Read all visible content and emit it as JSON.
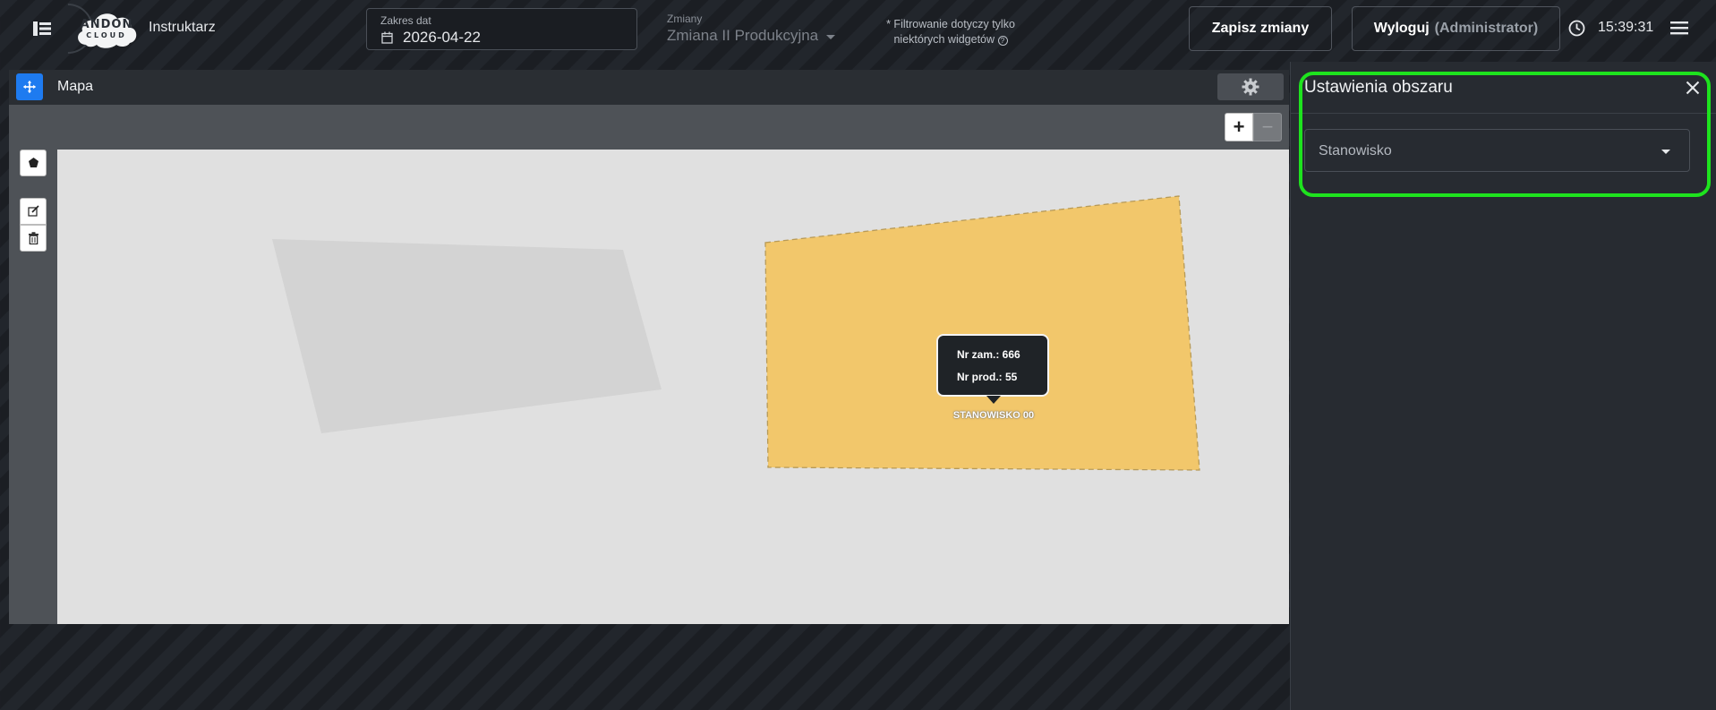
{
  "header": {
    "app_logo_line1": "ANDON",
    "app_logo_line2": "CLOUD",
    "role": "Instruktarz",
    "date_range_label": "Zakres dat",
    "date_value": "2026-04-22",
    "shift_label": "Zmiany",
    "shift_value": "Zmiana II Produkcyjna",
    "filter_note_line1": "* Filtrowanie dotyczy tylko",
    "filter_note_line2": "niektórych widgetów",
    "save_label": "Zapisz zmiany",
    "logout_label": "Wyloguj",
    "logout_user": "(Administrator)",
    "time": "15:39:31"
  },
  "widget": {
    "title": "Mapa",
    "zoom_in": "+",
    "zoom_out": "−",
    "tooltip_order": "Nr zam.: 666",
    "tooltip_product": "Nr prod.: 55",
    "station_label": "STANOWISKO 00",
    "area_color": "#f2c76b",
    "inactive_area_color": "#d3d3d3"
  },
  "side_panel": {
    "title": "Ustawienia obszaru",
    "station_placeholder": "Stanowisko"
  },
  "colors": {
    "accent": "#1e7bf0",
    "highlight": "#1ee31e"
  },
  "icons": {
    "sidebar_toggle": "sidebar-toggle-icon",
    "calendar": "calendar-icon",
    "clock": "clock-icon",
    "menu": "hamburger-menu-icon",
    "move": "move-arrows-icon",
    "gear": "gear-icon",
    "polygon": "polygon-draw-icon",
    "edit": "edit-layers-icon",
    "trash": "trash-icon",
    "close": "close-icon"
  }
}
